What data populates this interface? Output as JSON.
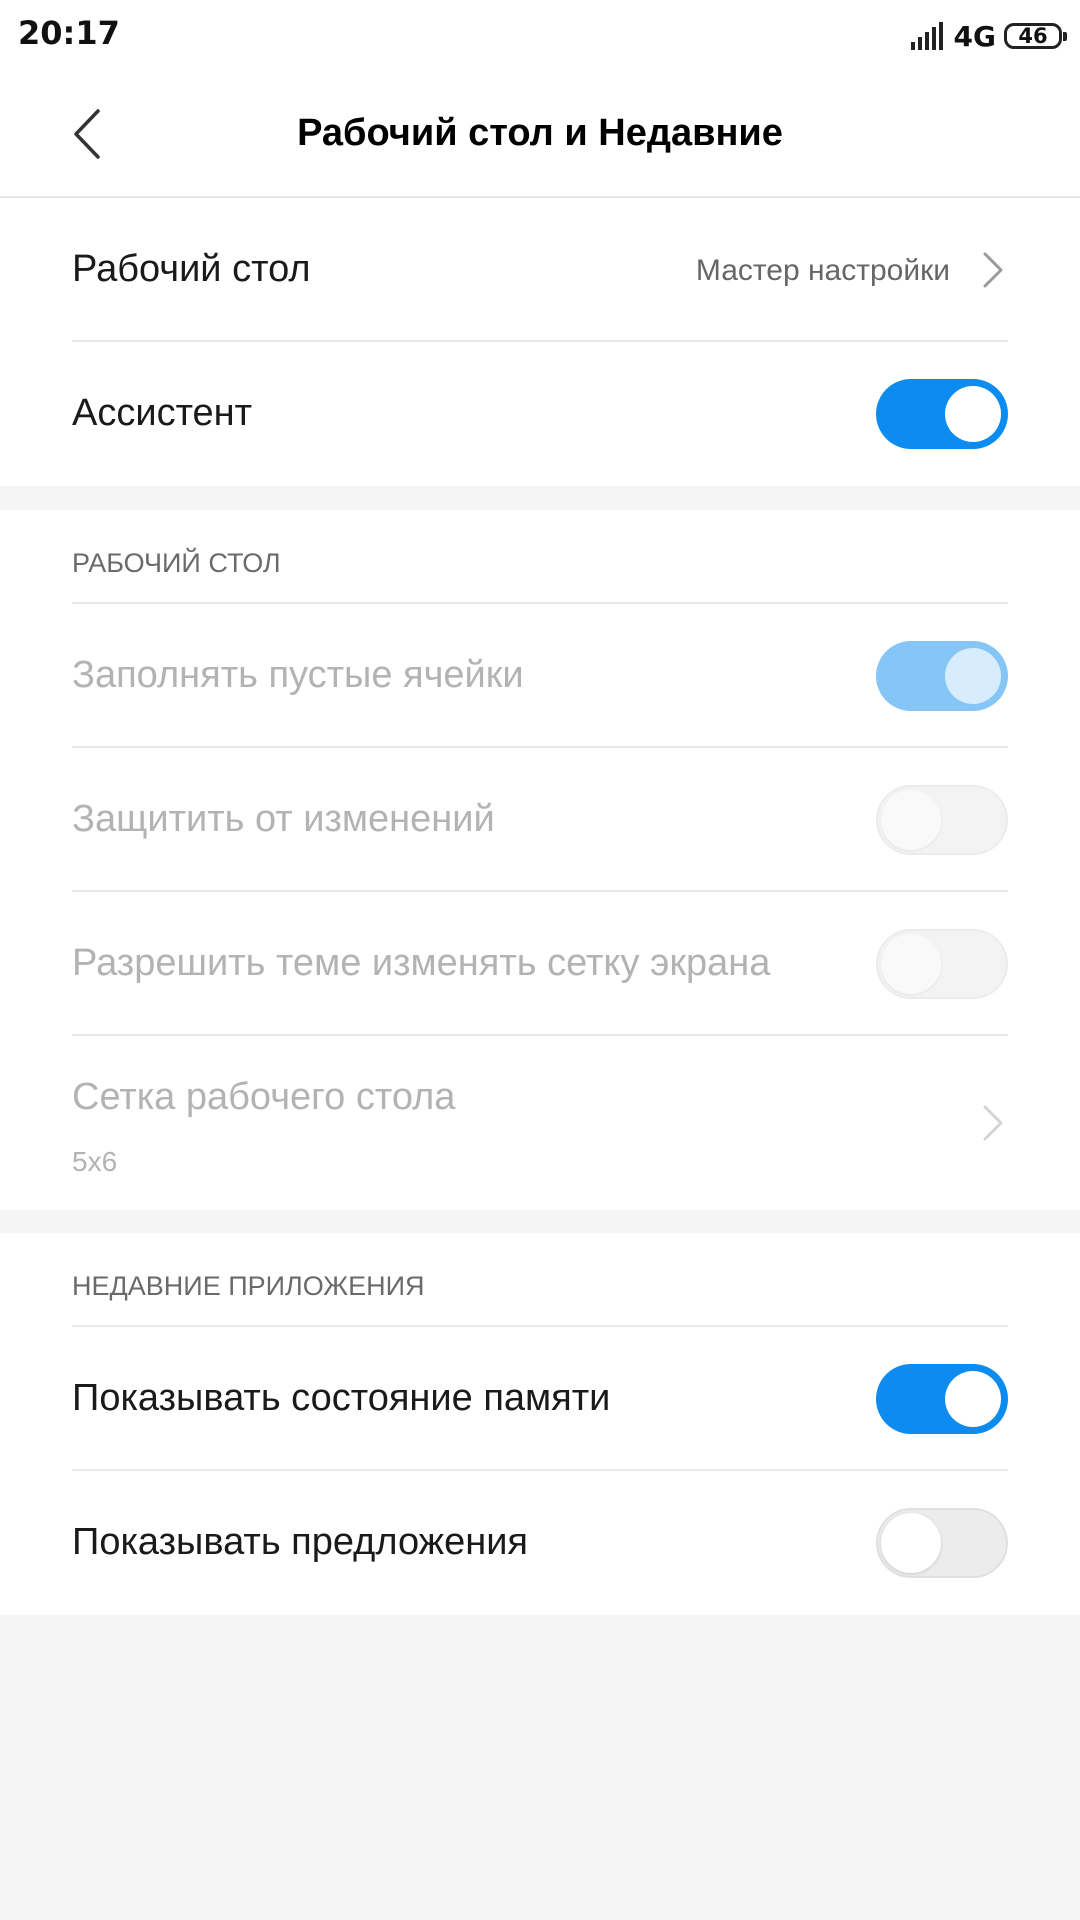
{
  "status_bar": {
    "time": "20:17",
    "network": "4G",
    "battery": "46"
  },
  "header": {
    "title": "Рабочий стол и Недавние",
    "back_icon": "chevron-left-icon"
  },
  "top_section": {
    "items": [
      {
        "label": "Рабочий стол",
        "value": "Мастер настройки",
        "icon": "chevron-right-icon"
      },
      {
        "label": "Ассистент",
        "toggle": "on"
      }
    ]
  },
  "desktop_section": {
    "header": "РАБОЧИЙ СТОЛ",
    "items": [
      {
        "label": "Заполнять пустые ячейки",
        "toggle": "on",
        "enabled": false
      },
      {
        "label": "Защитить от изменений",
        "toggle": "off",
        "enabled": false
      },
      {
        "label": "Разрешить теме изменять сетку экрана",
        "toggle": "off",
        "enabled": false
      },
      {
        "label": "Сетка рабочего стола",
        "value": "5x6",
        "icon": "chevron-right-icon",
        "enabled": false
      }
    ]
  },
  "recent_section": {
    "header": "НЕДАВНИЕ ПРИЛОЖЕНИЯ",
    "items": [
      {
        "label": "Показывать состояние памяти",
        "toggle": "on"
      },
      {
        "label": "Показывать предложения",
        "toggle": "off"
      }
    ]
  },
  "colors": {
    "accent": "#0c8cf0",
    "accent_disabled": "#85c6f7",
    "background": "#f5f5f5",
    "surface": "#ffffff"
  }
}
